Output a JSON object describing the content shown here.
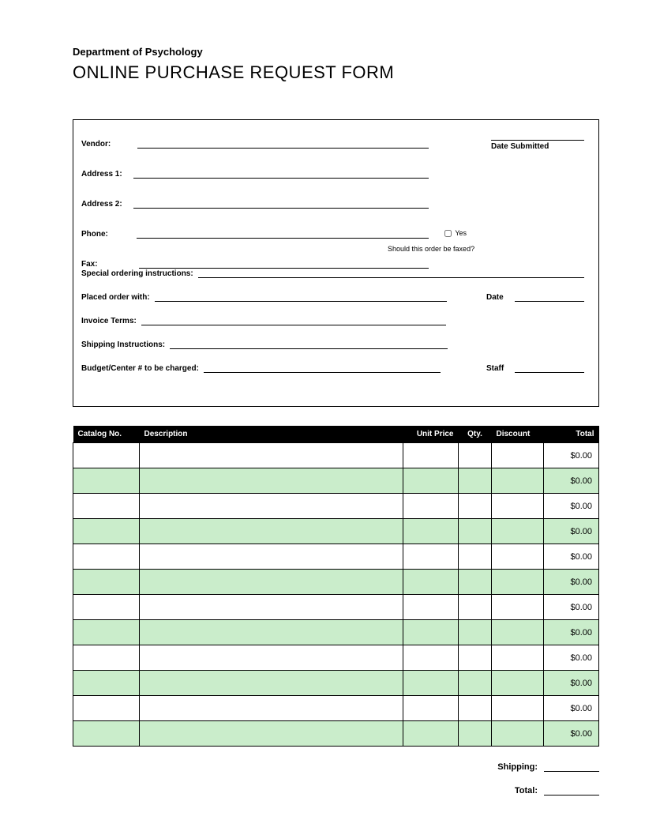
{
  "department": "Department of Psychology",
  "title": "ONLINE PURCHASE REQUEST FORM",
  "fields": {
    "vendor": "Vendor:",
    "date_submitted": "Date Submitted",
    "address1": "Address 1:",
    "address2": "Address 2:",
    "phone": "Phone:",
    "fax": "Fax:",
    "yes": "Yes",
    "fax_hint": "Should this order be faxed?",
    "special": "Special ordering instructions:",
    "placed_with": "Placed order with:",
    "date": "Date",
    "invoice_terms": "Invoice Terms:",
    "shipping_instr": "Shipping Instructions:",
    "budget": "Budget/Center # to be charged:",
    "staff": "Staff"
  },
  "table": {
    "headers": {
      "catalog": "Catalog No.",
      "description": "Description",
      "unit_price": "Unit Price",
      "qty": "Qty.",
      "discount": "Discount",
      "total": "Total"
    },
    "rows": [
      {
        "total": "$0.00"
      },
      {
        "total": "$0.00"
      },
      {
        "total": "$0.00"
      },
      {
        "total": "$0.00"
      },
      {
        "total": "$0.00"
      },
      {
        "total": "$0.00"
      },
      {
        "total": "$0.00"
      },
      {
        "total": "$0.00"
      },
      {
        "total": "$0.00"
      },
      {
        "total": "$0.00"
      },
      {
        "total": "$0.00"
      },
      {
        "total": "$0.00"
      }
    ]
  },
  "summary": {
    "shipping": "Shipping:",
    "total": "Total:"
  }
}
